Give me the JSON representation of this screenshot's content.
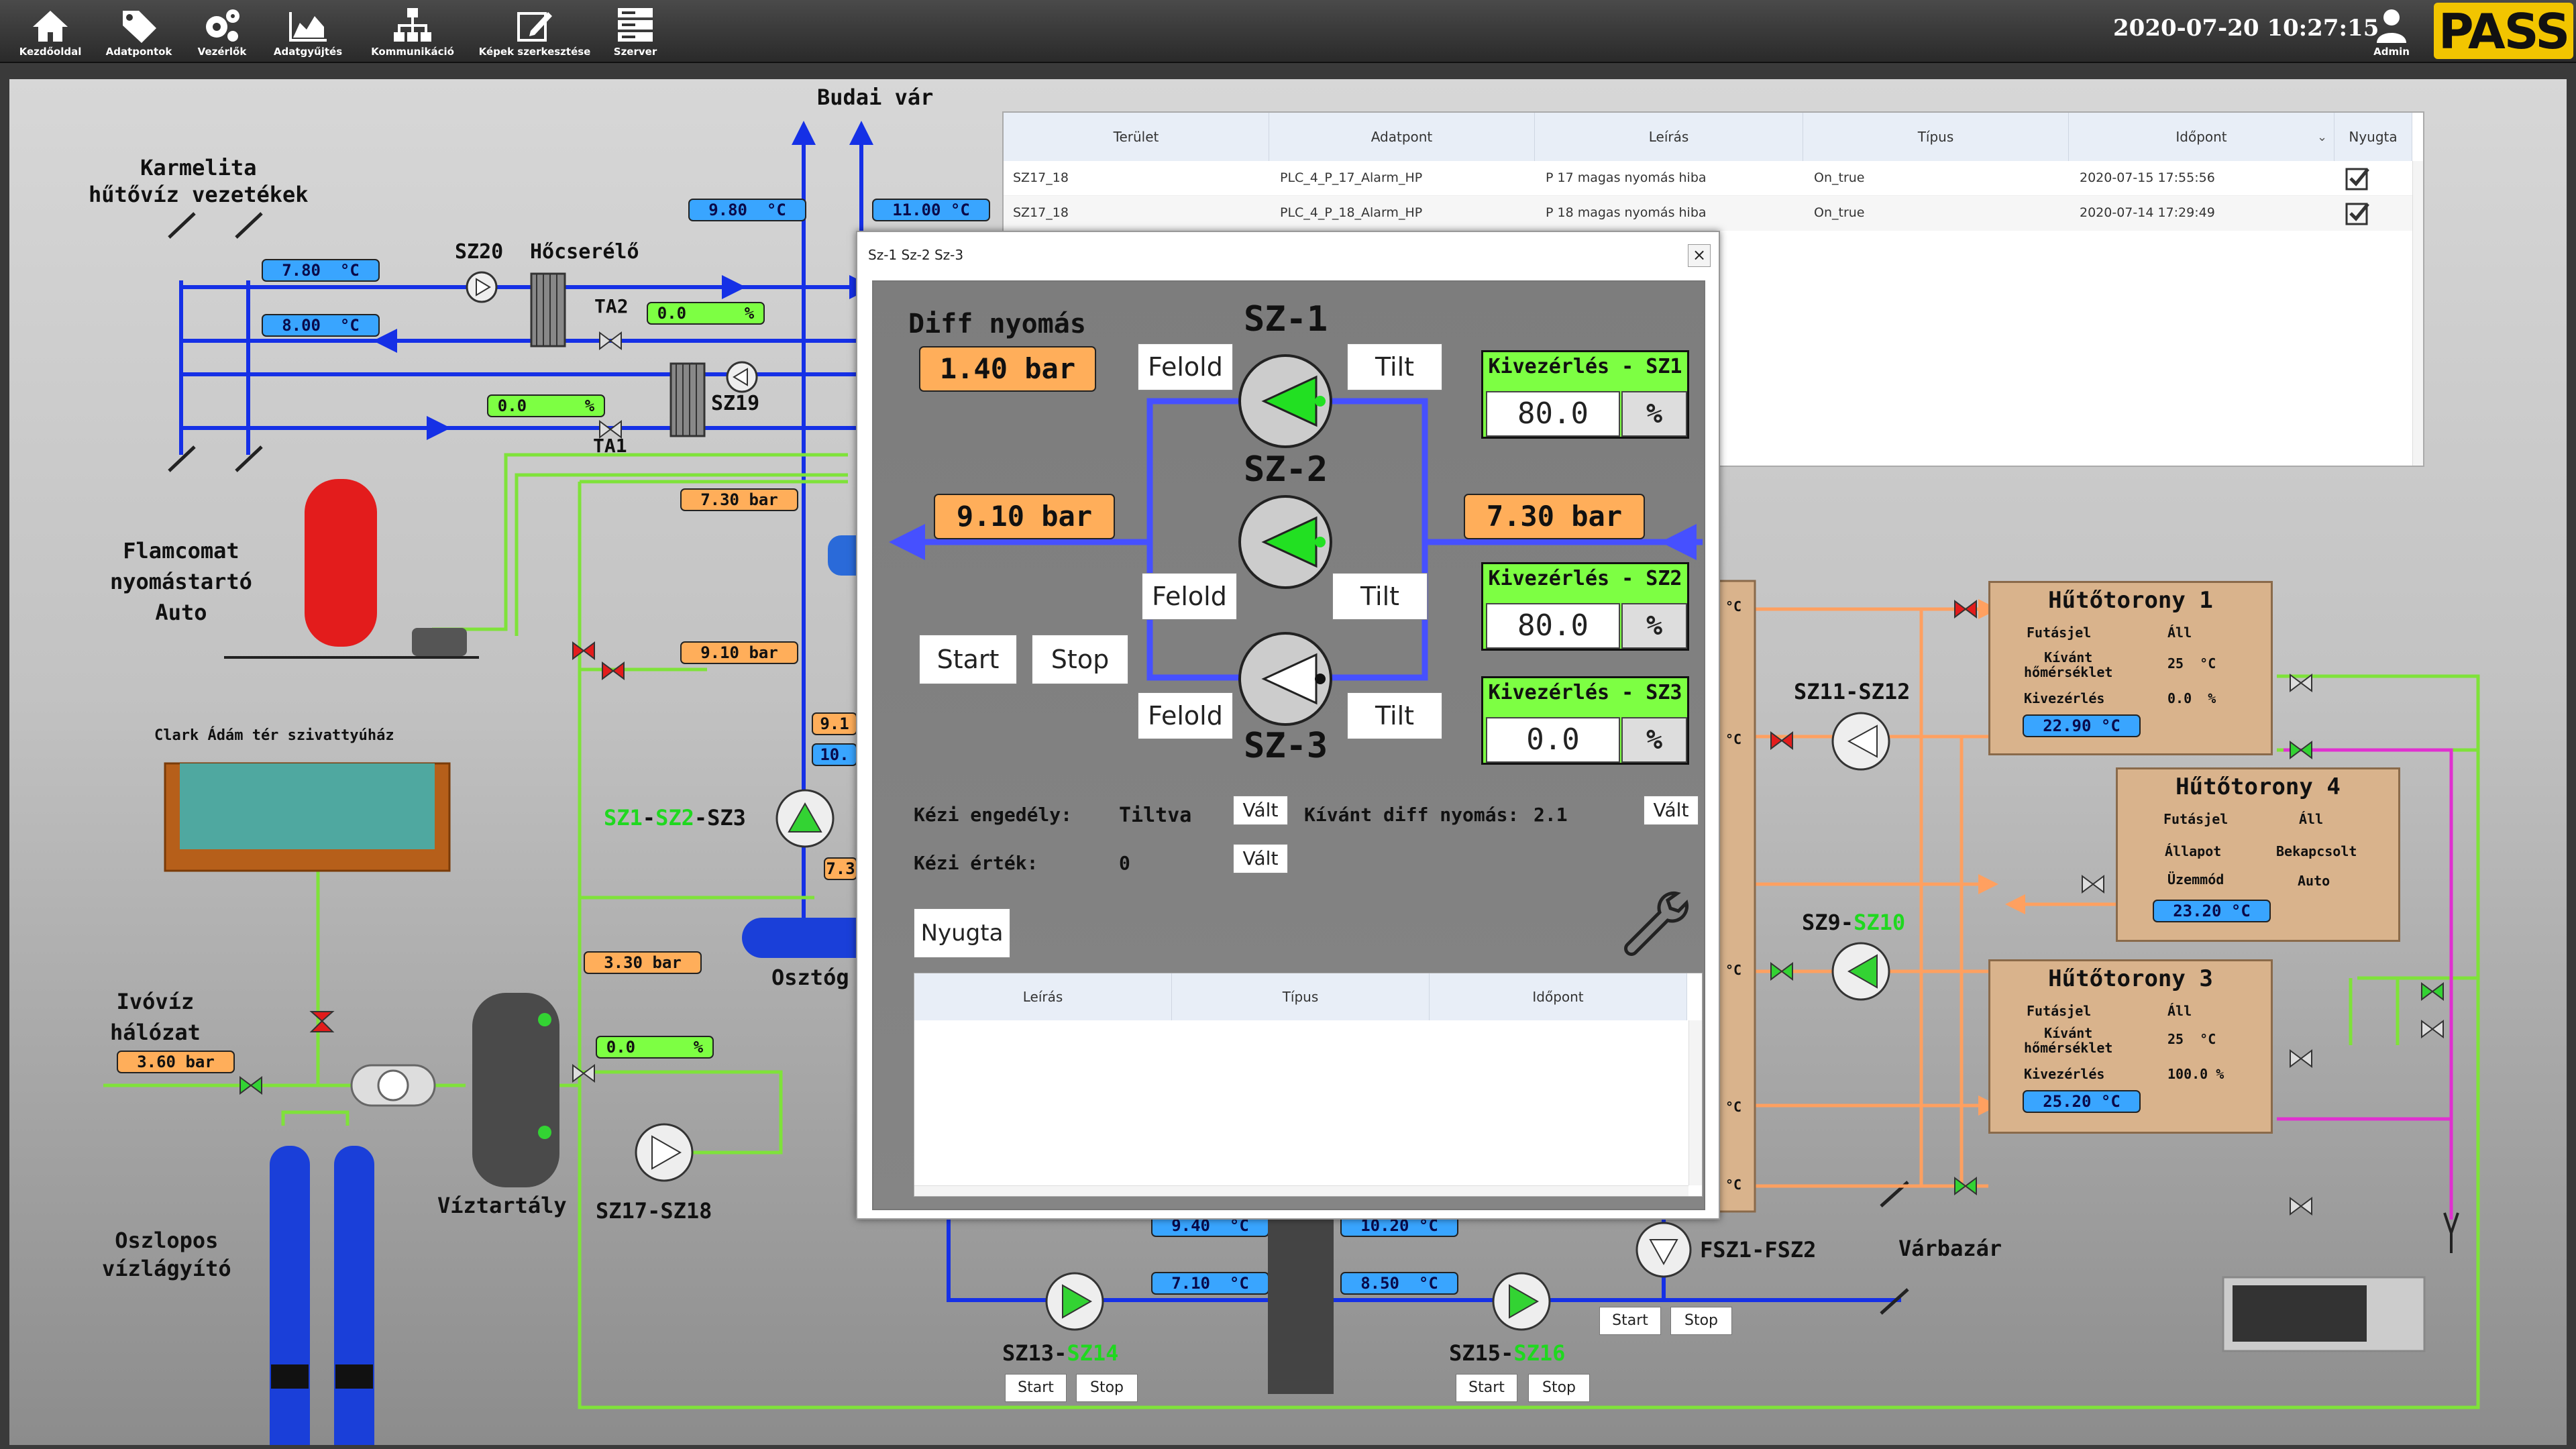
{
  "nav": {
    "items": [
      {
        "label": "Kezdőoldal",
        "icon": "home-icon"
      },
      {
        "label": "Adatpontok",
        "icon": "tag-icon"
      },
      {
        "label": "Vezérlők",
        "icon": "gears-icon"
      },
      {
        "label": "Adatgyűjtés",
        "icon": "area-chart-icon"
      },
      {
        "label": "Kommunikáció",
        "icon": "network-icon"
      },
      {
        "label": "Képek szerkesztése",
        "icon": "edit-icon"
      },
      {
        "label": "Szerver",
        "icon": "server-icon"
      }
    ],
    "datetime": "2020-07-20 10:27:15",
    "user": "Admin",
    "logo": "PASS"
  },
  "diagram": {
    "karmelita": "Karmelita\nhűtővíz vezetékek",
    "budai_var": "Budai vár",
    "sz20": "SZ20",
    "hocserelo": "Hőcserélő",
    "ta2": "TA2",
    "ta1": "TA1",
    "sz19": "SZ19",
    "flamcomat": "Flamcomat\nnyomástartó\nAuto",
    "clark": "Clark Ádám tér szivattyúház",
    "ivoviz": "Ivóvíz\nhálózat",
    "oszlopos": "Oszlopos\nvízlágyító",
    "viztartaly": "Víztartály",
    "sz17": "SZ17-SZ18",
    "osztoq": "Osztóg",
    "sz1": "SZ1",
    "sz2": "SZ2",
    "sz3": "SZ3",
    "dash": "-",
    "sz11": "SZ11-SZ12",
    "sz9": "SZ9",
    "sz10": "SZ10",
    "sz13": "SZ13",
    "sz14": "SZ14",
    "sz15": "SZ15",
    "sz16": "SZ16",
    "fsz": "FSZ1-FSZ2",
    "varbazar": "Várbazár",
    "t_780": "7.80  °C",
    "t_800": "8.00  °C",
    "t_980": "9.80  °C",
    "t_1100": "11.00 °C",
    "ta2_pct": "0.0      %",
    "ta1_pct": "0.0      %",
    "sz17_pct": "0.0      %",
    "p_730a": "7.30 bar",
    "p_910a": "9.10 bar",
    "p_330": "3.30 bar",
    "p_360": "3.60 bar",
    "p_91trunc": "9.1",
    "t_10trunc": "10.",
    "p_7trunc": "7.3",
    "t_940": "9.40  °C",
    "t_1020": "10.20 °C",
    "t_710": "7.10  °C",
    "t_850": "8.50  °C",
    "degc": "°C",
    "start": "Start",
    "stop": "Stop"
  },
  "towers": [
    {
      "title": "Hűtőtorony 1",
      "rows": [
        [
          "Futásjel",
          "Áll"
        ],
        [
          "Kívánt\nhőmérséklet",
          "25  °C"
        ],
        [
          "Kivezérlés",
          "0.0  %"
        ]
      ],
      "temp": "22.90 °C"
    },
    {
      "title": "Hűtőtorony 4",
      "rows": [
        [
          "Futásjel",
          "Áll"
        ],
        [
          "Állapot",
          "Bekapcsolt"
        ],
        [
          "Üzemmód",
          "Auto"
        ]
      ],
      "temp": "23.20 °C"
    },
    {
      "title": "Hűtőtorony 3",
      "rows": [
        [
          "Futásjel",
          "Áll"
        ],
        [
          "Kívánt\nhőmérséklet",
          "25  °C"
        ],
        [
          "Kivezérlés",
          "100.0 %"
        ]
      ],
      "temp": "25.20 °C"
    }
  ],
  "alarm_table": {
    "headers": [
      "Terület",
      "Adatpont",
      "Leírás",
      "Típus",
      "Időpont",
      "Nyugta"
    ],
    "rows": [
      [
        "SZ17_18",
        "PLC_4_P_17_Alarm_HP",
        "P 17 magas nyomás hiba",
        "On_true",
        "2020-07-15 17:55:56"
      ],
      [
        "SZ17_18",
        "PLC_4_P_18_Alarm_HP",
        "P 18 magas nyomás hiba",
        "On_true",
        "2020-07-14 17:29:49"
      ]
    ]
  },
  "dialog": {
    "title": "Sz-1 Sz-2 Sz-3",
    "close": "×",
    "diff_label": "Diff nyomás",
    "diff_value": "1.40 bar",
    "sz1": "SZ-1",
    "sz2": "SZ-2",
    "sz3": "SZ-3",
    "feloldo": "Felold",
    "tilt": "Tilt",
    "left_pressure": "9.10 bar",
    "right_pressure": "7.30 bar",
    "start": "Start",
    "stop": "Stop",
    "kiv1_label": "Kivezérlés - SZ1",
    "kiv1_val": "80.0",
    "kiv2_label": "Kivezérlés - SZ2",
    "kiv2_val": "80.0",
    "kiv3_label": "Kivezérlés - SZ3",
    "kiv3_val": "0.0",
    "pct": "%",
    "kezi_eng_label": "Kézi engedély:",
    "kezi_eng_val": "Tiltva",
    "valt": "Vált",
    "kivant_label": "Kívánt diff nyomás:",
    "kivant_val": "2.1",
    "kezi_ert_label": "Kézi érték:",
    "kezi_ert_val": "0",
    "nyugta": "Nyugta",
    "inner_headers": [
      "Leírás",
      "Típus",
      "Időpont"
    ]
  }
}
